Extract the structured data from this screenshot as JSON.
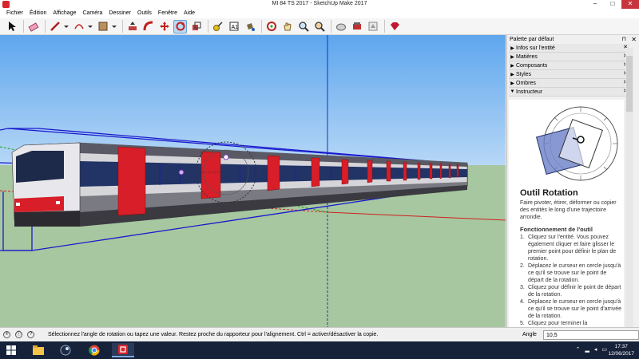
{
  "window": {
    "title": "MI 84  TS 2017 - SketchUp Make 2017",
    "minimize_icon": "minimize-icon",
    "maximize_icon": "maximize-icon",
    "close_icon": "close-icon"
  },
  "menu": [
    "Fichier",
    "Édition",
    "Affichage",
    "Caméra",
    "Dessiner",
    "Outils",
    "Fenêtre",
    "Aide"
  ],
  "toolbar": {
    "tools": [
      {
        "name": "select-tool",
        "icon": "arrow-icon"
      },
      {
        "name": "eraser-tool",
        "icon": "eraser-icon"
      },
      {
        "name": "line-tool",
        "icon": "pencil-icon"
      },
      {
        "name": "arc-tool",
        "icon": "arc-icon"
      },
      {
        "name": "rectangle-tool",
        "icon": "rectangle-icon"
      },
      {
        "name": "push-pull-tool",
        "icon": "push-pull-icon"
      },
      {
        "name": "follow-me-tool",
        "icon": "follow-me-icon"
      },
      {
        "name": "move-tool",
        "icon": "move-icon"
      },
      {
        "name": "rotate-tool",
        "icon": "rotate-icon",
        "active": true
      },
      {
        "name": "scale-tool",
        "icon": "scale-icon"
      },
      {
        "name": "tape-measure-tool",
        "icon": "tape-icon"
      },
      {
        "name": "text-tool",
        "icon": "text-icon"
      },
      {
        "name": "paint-bucket-tool",
        "icon": "paint-bucket-icon"
      },
      {
        "name": "orbit-tool",
        "icon": "orbit-icon"
      },
      {
        "name": "pan-tool",
        "icon": "hand-icon"
      },
      {
        "name": "zoom-tool",
        "icon": "magnifier-icon"
      },
      {
        "name": "zoom-extents-tool",
        "icon": "zoom-extents-icon"
      },
      {
        "name": "warehouse-tool",
        "icon": "warehouse-icon"
      },
      {
        "name": "extension-warehouse-tool",
        "icon": "extension-icon"
      },
      {
        "name": "send-to-layout-tool",
        "icon": "layout-icon"
      },
      {
        "name": "ruby-tool",
        "icon": "ruby-icon"
      }
    ]
  },
  "panel": {
    "title": "Palette par défaut",
    "pin_icon": "pin-icon",
    "close_icon": "close-icon",
    "trays": [
      {
        "label": "Infos sur l'entité",
        "expanded": false
      },
      {
        "label": "Matières",
        "expanded": false
      },
      {
        "label": "Composants",
        "expanded": false
      },
      {
        "label": "Styles",
        "expanded": false
      },
      {
        "label": "Ombres",
        "expanded": false
      },
      {
        "label": "Instructeur",
        "expanded": true
      }
    ],
    "instructor": {
      "title": "Outil Rotation",
      "description": "Faire pivoter, étirer, déformer ou copier des entités le long d'une trajectoire arrondie.",
      "subtitle": "Fonctionnement de l'outil",
      "steps": [
        "Cliquez sur l'entité. Vous pouvez également cliquer et faire glisser le premier point pour définir le plan de rotation.",
        "Déplacez le curseur en cercle jusqu'à ce qu'il se trouve sur le point de départ de la rotation.",
        "Cliquez pour définir le point de départ de la rotation.",
        "Déplacez le curseur en cercle jusqu'à ce qu'il se trouve sur le point d'arrivée de la rotation.",
        "Cliquez pour terminer la"
      ]
    }
  },
  "status": {
    "icons": [
      "geo-icon",
      "credits-icon",
      "help-icon"
    ],
    "message": "Sélectionnez l'angle de rotation ou tapez une valeur.  Restez proche du rapporteur pour l'alignement. Ctrl = activer/désactiver la copie.",
    "vcb_label": "Angle",
    "vcb_value": "10,5"
  },
  "taskbar": {
    "apps": [
      "file-explorer-icon",
      "steam-icon",
      "chrome-icon",
      "sketchup-icon"
    ],
    "time": "17:37",
    "date": "12/06/2017"
  },
  "colors": {
    "sky": "#7fb6f0",
    "ground": "#a8c8a0",
    "train_body": "#d8d8dc",
    "train_red": "#d81e28",
    "selection": "#1a1acc",
    "active_tool": "#bcd8f2",
    "taskbar": "#16213a"
  }
}
